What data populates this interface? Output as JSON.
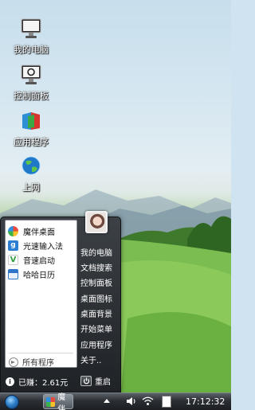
{
  "desktop": {
    "icons": [
      {
        "label": "我的电脑",
        "icon": "computer-icon"
      },
      {
        "label": "控制面板",
        "icon": "control-panel-icon"
      },
      {
        "label": "应用程序",
        "icon": "applications-icon"
      },
      {
        "label": "上网",
        "icon": "internet-globe-icon"
      }
    ]
  },
  "start_menu": {
    "programs": [
      {
        "label": "魔伴桌面",
        "icon": "mobanner-desktop-icon"
      },
      {
        "label": "光速输入法",
        "icon": "input-method-icon"
      },
      {
        "label": "音速启动",
        "icon": "launcher-icon"
      },
      {
        "label": "哈哈日历",
        "icon": "calendar-icon"
      }
    ],
    "all_programs": "所有程序",
    "right_items": [
      "我的电脑",
      "文档搜索",
      "控制面板",
      "桌面图标",
      "桌面背景",
      "开始菜单",
      "应用程序",
      "关于.."
    ],
    "earned_label": "已赚：",
    "earned_value": "2.61元",
    "restart": "重启"
  },
  "taskbar": {
    "app_label": "魔伴",
    "clock": "17:12:32"
  },
  "colors": {
    "menu_bg": "#2a2e33",
    "taskbar_bg": "#2b2f34",
    "accent_blue": "#2f7fc8"
  }
}
